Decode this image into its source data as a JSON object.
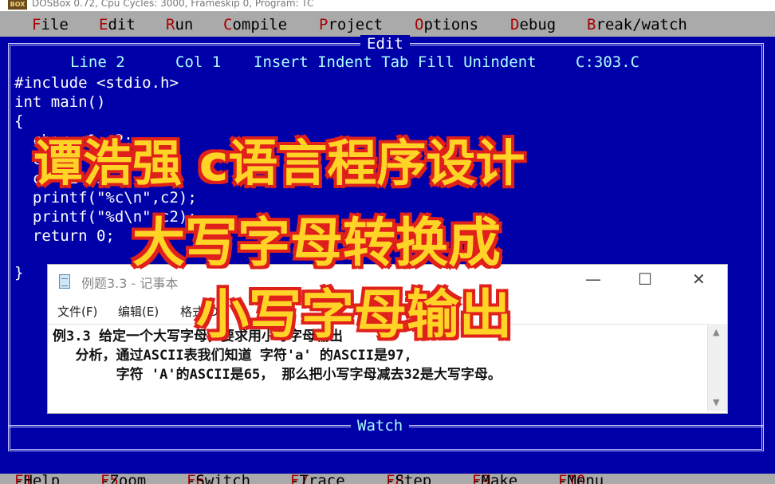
{
  "dosbox": {
    "icon_label": "BOX",
    "title": "DOSBox 0.72, Cpu Cycles:     3000, Frameskip  0, Program:    TC",
    "min": "—",
    "max": "☐",
    "close": "✕"
  },
  "menubar": {
    "items": [
      {
        "hot": "F",
        "rest": "ile"
      },
      {
        "hot": "E",
        "rest": "dit"
      },
      {
        "hot": "R",
        "rest": "un"
      },
      {
        "hot": "C",
        "rest": "ompile"
      },
      {
        "hot": "P",
        "rest": "roject"
      },
      {
        "hot": "O",
        "rest": "ptions"
      },
      {
        "hot": "D",
        "rest": "ebug"
      },
      {
        "hot": "B",
        "rest": "reak/watch"
      }
    ]
  },
  "editor": {
    "title": "Edit",
    "status": {
      "line": "Line 2",
      "col": "Col 1",
      "modes": "Insert Indent Tab Fill Unindent",
      "file": "C:303.C"
    },
    "code": [
      "#include <stdio.h>",
      "int main()",
      "{",
      "  char c1,c2;",
      "  c1='A';",
      "  c2=c1+32;",
      "  printf(\"%c\\n\",c2);",
      "  printf(\"%d\\n\",c2);",
      "  return 0;",
      "",
      "}"
    ],
    "watch_title": "Watch"
  },
  "fkeys": [
    {
      "key": "F1",
      "label": "-Help"
    },
    {
      "key": "F5",
      "label": "-Zoom"
    },
    {
      "key": "F6",
      "label": "-Switch"
    },
    {
      "key": "F7",
      "label": "-Trace"
    },
    {
      "key": "F8",
      "label": "-Step"
    },
    {
      "key": "F9",
      "label": "-Make"
    },
    {
      "key": "F10",
      "label": "-Menu"
    }
  ],
  "notepad": {
    "title": "例题3.3 - 记事本",
    "min": "—",
    "max": "☐",
    "close": "✕",
    "menu": [
      "文件(F)",
      "编辑(E)",
      "格式(O)"
    ],
    "lines": [
      "例3.3 给定一个大写字母，要求用小写字母输出",
      "  分析，通过ASCII表我们知道 字符'a' 的ASCII是97,",
      "       字符 'A'的ASCII是65， 那么把小写字母减去32是大写字母。"
    ]
  },
  "overlay": {
    "line1": "谭浩强 c语言程序设计",
    "line2": "大写字母转换成",
    "line3": "小写字母输出"
  },
  "colors": {
    "screen_bg": "#0000a8",
    "menu_bg": "#aaaaaa",
    "hotkey": "#a80000",
    "overlay_fill": "#ffd426",
    "overlay_outline": "#e0201a"
  }
}
